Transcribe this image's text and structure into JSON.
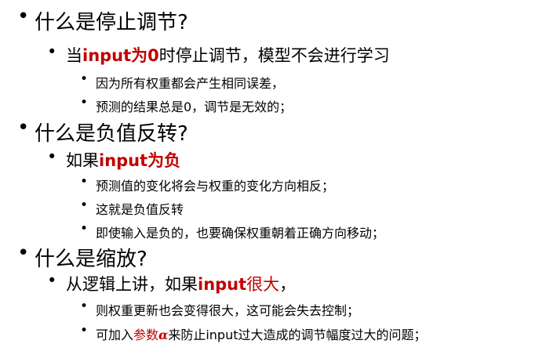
{
  "colors": {
    "text": "#000000",
    "highlight": "#c00000",
    "background": "#ffffff"
  },
  "sections": [
    {
      "heading": "什么是停止调节?",
      "sub": {
        "pre": "当",
        "hl": "input为0",
        "post": "时停止调节，模型不会进行学习"
      },
      "items": [
        "因为所有权重都会产生相同误差，",
        "预测的结果总是0，调节是无效的；"
      ]
    },
    {
      "heading": "什么是负值反转?",
      "sub": {
        "pre": "如果",
        "hl": "input为负",
        "post": ""
      },
      "items": [
        "预测值的变化将会与权重的变化方向相反；",
        "这就是负值反转",
        "即使输入是负的，也要确保权重朝着正确方向移动；"
      ]
    },
    {
      "heading": "什么是缩放?",
      "sub": {
        "pre": "从逻辑上讲，如果",
        "hl_bold": "input",
        "hl_normal": "很大",
        "post": "，"
      },
      "items": [
        "则权重更新也会变得很大，这可能会失去控制；"
      ],
      "last_item": {
        "pre": "可加入",
        "hl": "参数",
        "alpha": "α",
        "post": "来防止input过大造成的调节幅度过大的问题；"
      }
    }
  ]
}
